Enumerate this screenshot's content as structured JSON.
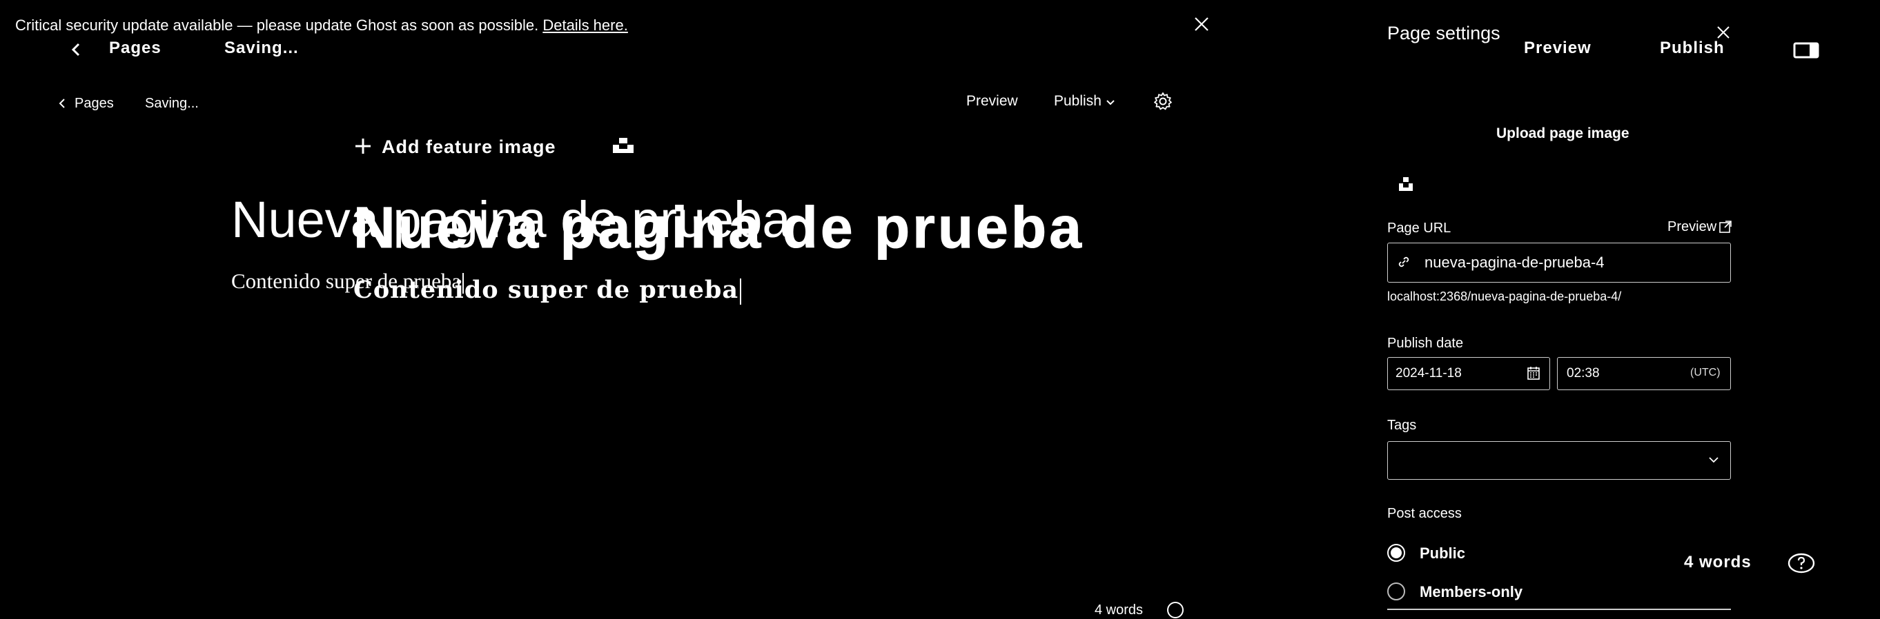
{
  "banner": {
    "text": "Critical security update available — please update Ghost as soon as possible. ",
    "link": "Details here."
  },
  "ghost_header": {
    "back": "<",
    "pages": "Pages",
    "saving": "Saving..."
  },
  "editor_header": {
    "pages": "Pages",
    "saving": "Saving...",
    "preview": "Preview",
    "publish": "Publish"
  },
  "feature_image": {
    "label": "Add feature image"
  },
  "post": {
    "title": "Nueva pagina de prueba",
    "body": "Contenido super de prueba"
  },
  "word_count": {
    "label": "4 words"
  },
  "sidebar": {
    "title": "Page settings",
    "preview": "Preview",
    "publish": "Publish",
    "upload_label": "Upload page image",
    "page_url": {
      "label": "Page URL",
      "preview": "Preview",
      "value": "nueva-pagina-de-prueba-4",
      "hint": "localhost:2368/nueva-pagina-de-prueba-4/"
    },
    "publish_date": {
      "label": "Publish date",
      "date": "2024-11-18",
      "time": "02:38",
      "tz": "(UTC)"
    },
    "tags": {
      "label": "Tags",
      "value": ""
    },
    "post_access": {
      "label": "Post access",
      "options": [
        "Public",
        "Members-only"
      ],
      "selected": "Public"
    }
  }
}
